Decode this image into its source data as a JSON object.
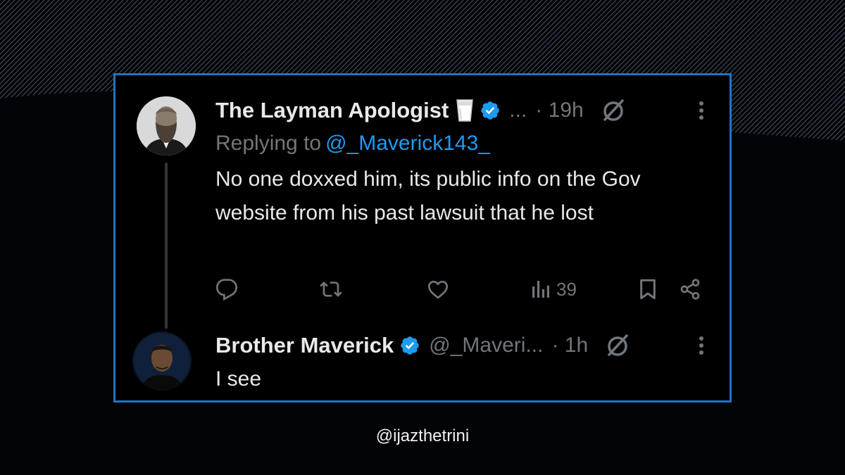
{
  "tweets": [
    {
      "name": "The Layman Apologist",
      "handle": "...",
      "separator": "·",
      "time": "19h",
      "reply_prefix": "Replying to",
      "reply_to": "@_Maverick143_",
      "text": "No one doxxed him, its public info on the Gov website from his past lawsuit that he lost",
      "views": "39"
    },
    {
      "name": "Brother Maverick",
      "handle": "@_Maveri...",
      "separator": "·",
      "time": "1h",
      "text": "I see"
    }
  ],
  "icons": {
    "verified": "verified-badge-icon",
    "grok": "grok-icon",
    "more": "more-vertical-icon",
    "reply": "reply-icon",
    "repost": "repost-icon",
    "like": "heart-icon",
    "views": "views-icon",
    "bookmark": "bookmark-icon",
    "share": "share-icon",
    "emoji": "milk-glass-icon"
  },
  "colors": {
    "accent": "#1d9bf0",
    "frame": "#1d73c9",
    "muted": "#71767b",
    "text": "#e7e9ea",
    "background": "#030407"
  },
  "watermark": "@ijazthetrini"
}
